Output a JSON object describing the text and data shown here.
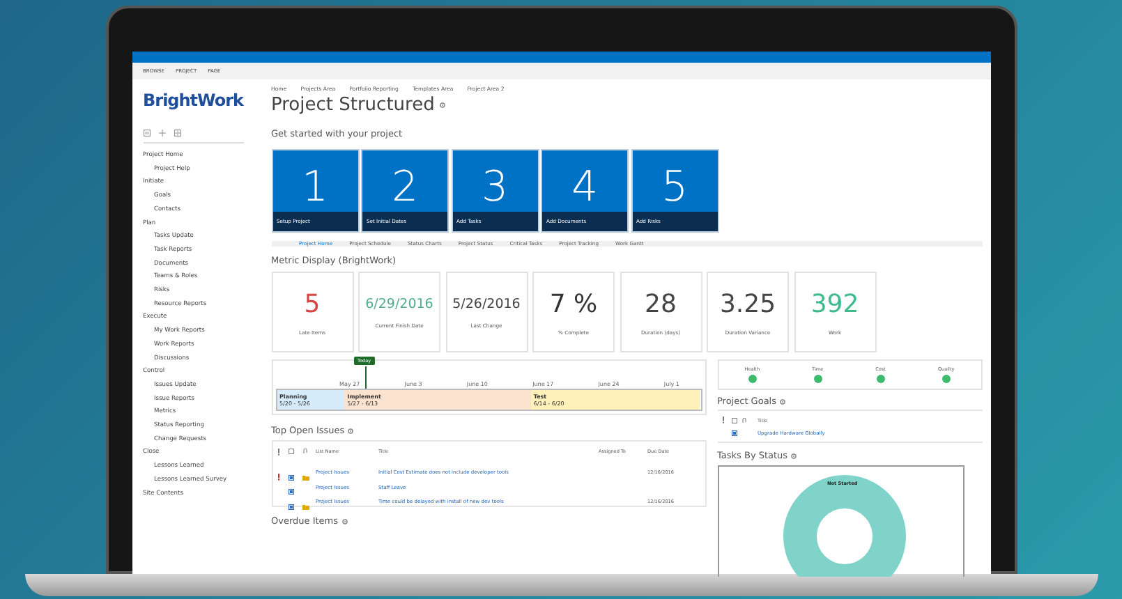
{
  "ribbon": {
    "tabs": [
      "BROWSE",
      "PROJECT",
      "PAGE"
    ]
  },
  "logo": "BrightWork",
  "breadcrumbs": [
    "Home",
    "Projects Area",
    "Portfolio Reporting",
    "Templates Area",
    "Project Area 2"
  ],
  "page_title": "Project Structured",
  "sidebar": {
    "items": [
      {
        "label": "Project Home",
        "children": [
          {
            "label": "Project Help"
          }
        ]
      },
      {
        "label": "Initiate",
        "children": [
          {
            "label": "Goals"
          },
          {
            "label": "Contacts"
          }
        ]
      },
      {
        "label": "Plan",
        "children": [
          {
            "label": "Tasks Update"
          },
          {
            "label": "Task Reports"
          },
          {
            "label": "Documents"
          },
          {
            "label": "Teams & Roles"
          },
          {
            "label": "Risks"
          },
          {
            "label": "Resource Reports"
          }
        ]
      },
      {
        "label": "Execute",
        "children": [
          {
            "label": "My Work Reports"
          },
          {
            "label": "Work Reports"
          },
          {
            "label": "Discussions"
          }
        ]
      },
      {
        "label": "Control",
        "children": [
          {
            "label": "Issues Update"
          },
          {
            "label": "Issue Reports"
          },
          {
            "label": "Metrics"
          },
          {
            "label": "Status Reporting"
          },
          {
            "label": "Change Requests"
          }
        ]
      },
      {
        "label": "Close",
        "children": [
          {
            "label": "Lessons Learned"
          },
          {
            "label": "Lessons Learned Survey"
          }
        ]
      },
      {
        "label": "Site Contents"
      }
    ]
  },
  "get_started": {
    "heading": "Get started with your project",
    "tiles": [
      {
        "number": "1",
        "label": "Setup Project"
      },
      {
        "number": "2",
        "label": "Set Initial Dates"
      },
      {
        "number": "3",
        "label": "Add Tasks"
      },
      {
        "number": "4",
        "label": "Add Documents"
      },
      {
        "number": "5",
        "label": "Add Risks"
      }
    ]
  },
  "tabs": [
    {
      "label": "Project Home",
      "selected": true
    },
    {
      "label": "Project Schedule",
      "selected": false
    },
    {
      "label": "Status Charts",
      "selected": false
    },
    {
      "label": "Project Status",
      "selected": false
    },
    {
      "label": "Critical Tasks",
      "selected": false
    },
    {
      "label": "Project Tracking",
      "selected": false
    },
    {
      "label": "Work Gantt",
      "selected": false
    }
  ],
  "metrics": {
    "heading": "Metric Display (BrightWork)",
    "cards": [
      {
        "value": "5",
        "label": "Late Items",
        "color": "#d9443f"
      },
      {
        "value": "6/29/2016",
        "label": "Current Finish Date",
        "color": "#4fae8a"
      },
      {
        "value": "5/26/2016",
        "label": "Last Change",
        "color": "#444444"
      },
      {
        "value": "7 %",
        "label": "% Complete",
        "color": "#333333"
      },
      {
        "value": "28",
        "label": "Duration (days)",
        "color": "#444444"
      },
      {
        "value": "3.25",
        "label": "Duration Variance",
        "color": "#444444"
      },
      {
        "value": "392",
        "label": "Work",
        "color": "#3dbb8a"
      }
    ]
  },
  "timeline": {
    "today": "Today",
    "dates": [
      "May 27",
      "June 3",
      "June 10",
      "June 17",
      "June 24",
      "July 1"
    ],
    "phases": [
      {
        "name": "Planning",
        "dates": "5/20 - 5/26",
        "color": "#d6ecfb"
      },
      {
        "name": "Implement",
        "dates": "5/27 - 6/13",
        "color": "#fbe3cf"
      },
      {
        "name": "Test",
        "dates": "6/14 - 6/20",
        "color": "#fdf0b8"
      }
    ]
  },
  "top_open_issues": {
    "heading": "Top Open Issues",
    "columns": [
      "List Name",
      "Title",
      "Assigned To",
      "Due Date"
    ],
    "rows": [
      {
        "high_priority": true,
        "attachment": true,
        "list": "Project Issues",
        "title": "Initial Cost Estimate does not include developer tools",
        "assigned": "",
        "due": "12/16/2016"
      },
      {
        "high_priority": false,
        "attachment": false,
        "list": "Project Issues",
        "title": "Staff Leave",
        "assigned": "",
        "due": ""
      },
      {
        "high_priority": false,
        "attachment": true,
        "list": "Project Issues",
        "title": "Time could be delayed with install of new dev tools",
        "assigned": "",
        "due": "12/16/2016"
      }
    ]
  },
  "overdue_heading": "Overdue Items",
  "health": [
    {
      "label": "Health",
      "color": "#3dbb6e"
    },
    {
      "label": "Time",
      "color": "#3dbb6e"
    },
    {
      "label": "Cost",
      "color": "#3dbb6e"
    },
    {
      "label": "Quality",
      "color": "#3dbb6e"
    }
  ],
  "project_goals": {
    "heading": "Project Goals",
    "column": "Title",
    "rows": [
      "Upgrade Hardware Globally"
    ]
  },
  "tasks_by_status": {
    "heading": "Tasks By Status",
    "slice_label": "Not Started"
  }
}
